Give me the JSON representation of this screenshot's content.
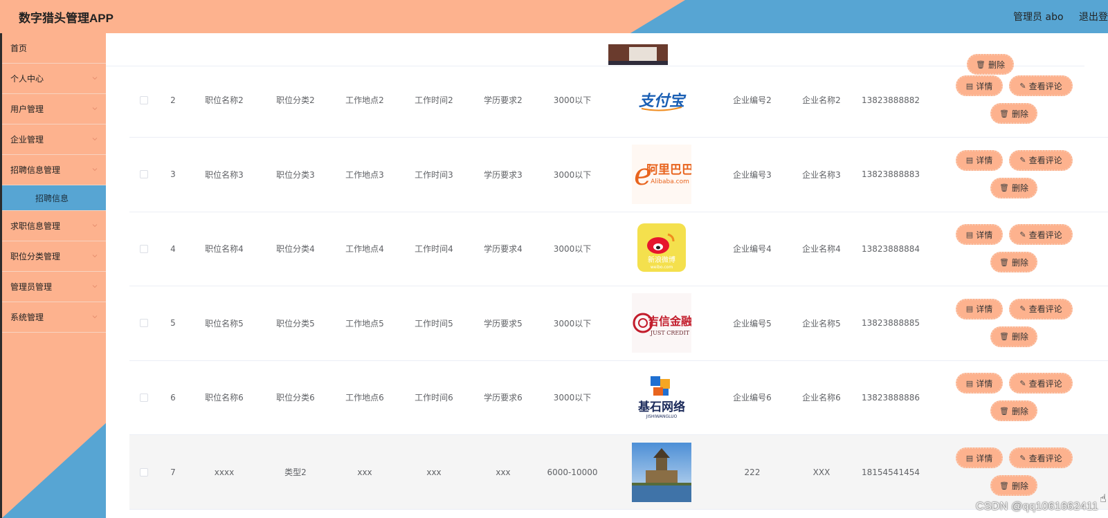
{
  "app": {
    "title": "数字猎头管理APP",
    "user_label": "管理员 abo",
    "logout_label": "退出登"
  },
  "sidebar": {
    "items": [
      {
        "label": "首页",
        "expandable": false
      },
      {
        "label": "个人中心",
        "expandable": true
      },
      {
        "label": "用户管理",
        "expandable": true
      },
      {
        "label": "企业管理",
        "expandable": true
      },
      {
        "label": "招聘信息管理",
        "expandable": true,
        "expanded": true
      },
      {
        "label": "求职信息管理",
        "expandable": true
      },
      {
        "label": "职位分类管理",
        "expandable": true
      },
      {
        "label": "管理员管理",
        "expandable": true
      },
      {
        "label": "系统管理",
        "expandable": true
      }
    ],
    "active_sub": "招聘信息"
  },
  "table": {
    "actions": {
      "detail": "详情",
      "comments": "查看评论",
      "delete": "删除"
    },
    "top_partial_delete": "删除",
    "rows": [
      {
        "no": "2",
        "position": "职位名称2",
        "category": "职位分类2",
        "location": "工作地点2",
        "hours": "工作时间2",
        "education": "学历要求2",
        "salary": "3000以下",
        "logo": "alipay-logo",
        "company_no": "企业编号2",
        "company": "企业名称2",
        "phone": "13823888882"
      },
      {
        "no": "3",
        "position": "职位名称3",
        "category": "职位分类3",
        "location": "工作地点3",
        "hours": "工作时间3",
        "education": "学历要求3",
        "salary": "3000以下",
        "logo": "alibaba-logo",
        "company_no": "企业编号3",
        "company": "企业名称3",
        "phone": "13823888883"
      },
      {
        "no": "4",
        "position": "职位名称4",
        "category": "职位分类4",
        "location": "工作地点4",
        "hours": "工作时间4",
        "education": "学历要求4",
        "salary": "3000以下",
        "logo": "weibo-logo",
        "company_no": "企业编号4",
        "company": "企业名称4",
        "phone": "13823888884"
      },
      {
        "no": "5",
        "position": "职位名称5",
        "category": "职位分类5",
        "location": "工作地点5",
        "hours": "工作时间5",
        "education": "学历要求5",
        "salary": "3000以下",
        "logo": "just-credit-logo",
        "company_no": "企业编号5",
        "company": "企业名称5",
        "phone": "13823888885"
      },
      {
        "no": "6",
        "position": "职位名称6",
        "category": "职位分类6",
        "location": "工作地点6",
        "hours": "工作时间6",
        "education": "学历要求6",
        "salary": "3000以下",
        "logo": "jishi-network-logo",
        "company_no": "企业编号6",
        "company": "企业名称6",
        "phone": "13823888886"
      },
      {
        "no": "7",
        "position": "xxxx",
        "category": "类型2",
        "location": "xxx",
        "hours": "xxx",
        "education": "xxx",
        "salary": "6000-10000",
        "logo": "scenic-photo",
        "company_no": "222",
        "company": "XXX",
        "phone": "18154541454"
      }
    ]
  },
  "logo_text": {
    "alipay": "支付宝",
    "alibaba_cn": "阿里巴巴",
    "alibaba_en": "Alibaba.com",
    "weibo_cn": "新浪微博",
    "weibo_en": "weibo.com",
    "credit_cn": "吉信金融",
    "credit_en": "JUST CREDIT",
    "jishi_cn": "基石网络",
    "jishi_en": "JISHIWANGLUO"
  },
  "watermark": "CSDN @qq1061662411",
  "colors": {
    "peach": "#fdb28e",
    "blue": "#57a5d3",
    "text": "#606266"
  }
}
